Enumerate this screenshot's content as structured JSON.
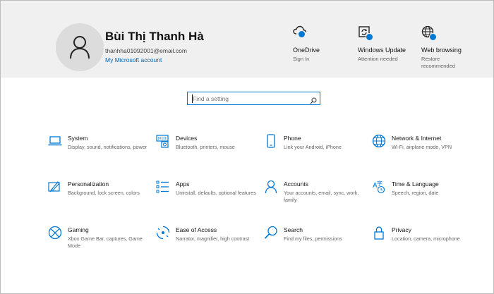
{
  "header": {
    "user_name": "Bùi Thị Thanh Hà",
    "user_email": "thanhha01092001@email.com",
    "account_link": "My Microsoft account",
    "status_items": [
      {
        "title": "OneDrive",
        "subtitle": "Sign In",
        "icon": "cloud-icon"
      },
      {
        "title": "Windows Update",
        "subtitle": "Attention needed",
        "icon": "update-icon"
      },
      {
        "title": "Web browsing",
        "subtitle": "Restore recommended",
        "icon": "globe-icon"
      }
    ]
  },
  "search": {
    "placeholder": "Find a setting"
  },
  "tiles": [
    {
      "title": "System",
      "desc": "Display, sound, notifications, power",
      "icon": "laptop-icon"
    },
    {
      "title": "Devices",
      "desc": "Bluetooth, printers, mouse",
      "icon": "devices-icon"
    },
    {
      "title": "Phone",
      "desc": "Link your Android, iPhone",
      "icon": "phone-icon"
    },
    {
      "title": "Network & Internet",
      "desc": "Wi-Fi, airplane mode, VPN",
      "icon": "globe-icon"
    },
    {
      "title": "Personalization",
      "desc": "Background, lock screen, colors",
      "icon": "paint-icon"
    },
    {
      "title": "Apps",
      "desc": "Uninstall, defaults, optional features",
      "icon": "apps-list-icon"
    },
    {
      "title": "Accounts",
      "desc": "Your accounts, email, sync, work, family",
      "icon": "person-icon"
    },
    {
      "title": "Time & Language",
      "desc": "Speech, region, date",
      "icon": "time-language-icon"
    },
    {
      "title": "Gaming",
      "desc": "Xbox Game Bar, captures, Game Mode",
      "icon": "xbox-icon"
    },
    {
      "title": "Ease of Access",
      "desc": "Narrator, magnifier, high contrast",
      "icon": "ease-of-access-icon"
    },
    {
      "title": "Search",
      "desc": "Find my files, permissions",
      "icon": "search-icon"
    },
    {
      "title": "Privacy",
      "desc": "Location, camera, microphone",
      "icon": "lock-icon"
    }
  ],
  "colors": {
    "accent": "#0078d4",
    "header_bg": "#f0f0f0",
    "link": "#0063b1"
  }
}
